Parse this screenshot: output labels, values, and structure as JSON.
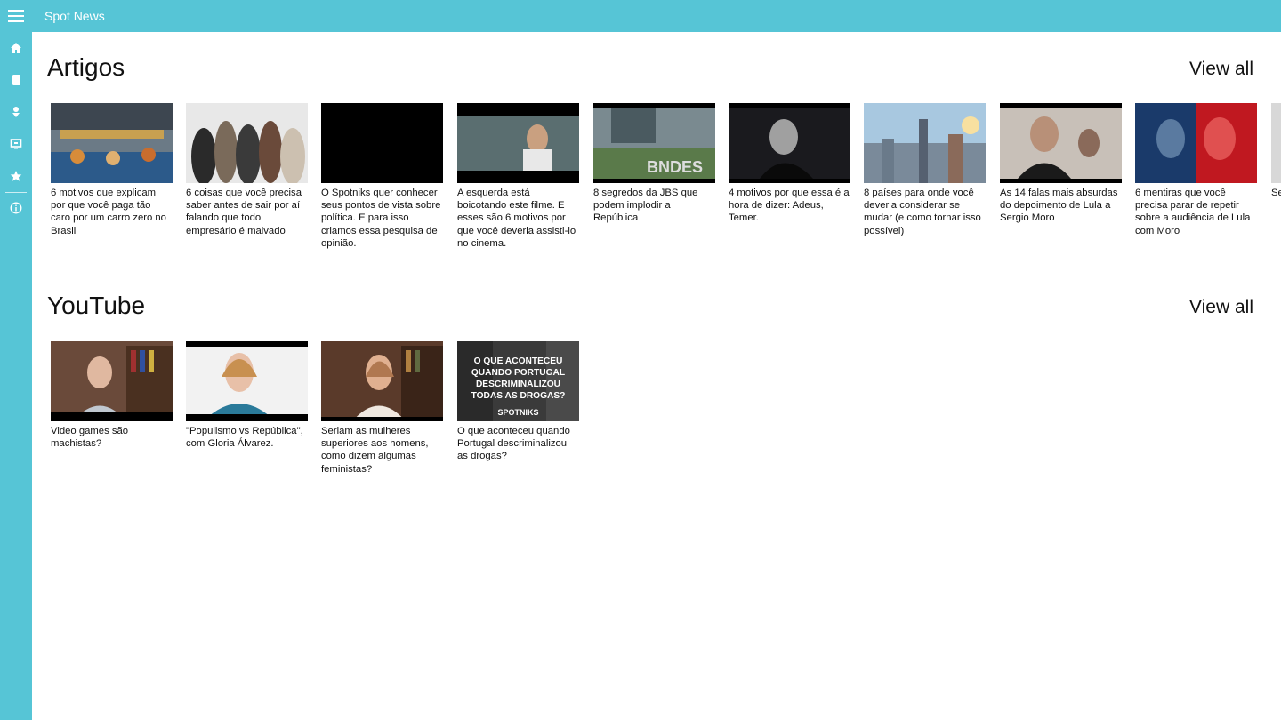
{
  "app": {
    "title": "Spot News"
  },
  "sidebar": {
    "items": [
      {
        "icon": "home-icon"
      },
      {
        "icon": "document-icon"
      },
      {
        "icon": "person-icon"
      },
      {
        "icon": "monitor-icon"
      },
      {
        "icon": "star-icon"
      },
      {
        "icon": "info-icon"
      }
    ]
  },
  "colors": {
    "accent": "#56c5d6"
  },
  "sections": [
    {
      "title": "Artigos",
      "view_all": "View all",
      "items": [
        {
          "caption": "6 motivos que explicam por que você paga tão caro por um carro zero no Brasil"
        },
        {
          "caption": "6 coisas que você precisa saber antes de sair por aí falando que todo empresário é malvado"
        },
        {
          "caption": "O Spotniks quer conhecer seus pontos de vista sobre política. E para isso criamos essa pesquisa de opinião."
        },
        {
          "caption": "A esquerda está boicotando este filme. E esses são 6 motivos por que você deveria assisti-lo no cinema."
        },
        {
          "caption": "8 segredos da JBS que podem implodir a República"
        },
        {
          "caption": "4 motivos por que essa é a hora de dizer: Adeus, Temer."
        },
        {
          "caption": "8 países para onde você deveria considerar se mudar (e como tornar isso possível)"
        },
        {
          "caption": "As 14 falas mais absurdas do depoimento de Lula a Sergio Moro"
        },
        {
          "caption": "6 mentiras que você precisa parar de repetir sobre a audiência de Lula com Moro"
        },
        {
          "caption": "Se não nas"
        }
      ]
    },
    {
      "title": "YouTube",
      "view_all": "View all",
      "items": [
        {
          "caption": "Video games são machistas?"
        },
        {
          "caption": "\"Populismo vs República\", com Gloria Álvarez."
        },
        {
          "caption": "Seriam as mulheres superiores aos homens, como dizem algumas feministas?"
        },
        {
          "caption": "O que aconteceu quando Portugal descriminalizou as drogas?",
          "thumb_text": "O QUE ACONTECEU QUANDO PORTUGAL DESCRIMINALIZOU TODAS AS DROGAS?",
          "thumb_brand": "SPOTNIKS"
        }
      ]
    }
  ]
}
